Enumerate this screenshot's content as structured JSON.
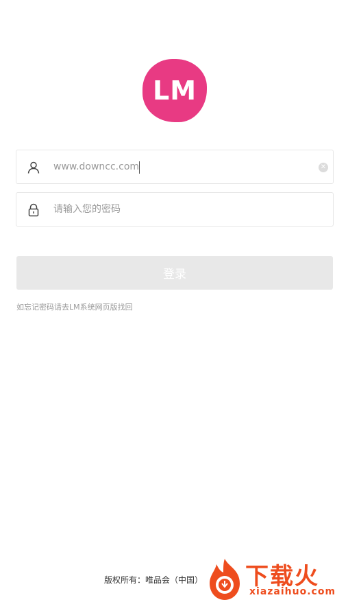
{
  "logo": {
    "text": "LM",
    "color": "#e83a83"
  },
  "login_form": {
    "username": {
      "icon": "user-icon",
      "value": "www.downcc.com",
      "clear_icon": "clear-icon"
    },
    "password": {
      "icon": "lock-icon",
      "placeholder": "请输入您的密码"
    },
    "submit_label": "登录"
  },
  "hint": "如忘记密码请去LM系统网页版找回",
  "footer": {
    "copyright": "版权所有：唯品会（中国）"
  },
  "watermark": {
    "cn": "下载火",
    "en": "xiazaihuo.com",
    "color": "#ee4d1e"
  }
}
